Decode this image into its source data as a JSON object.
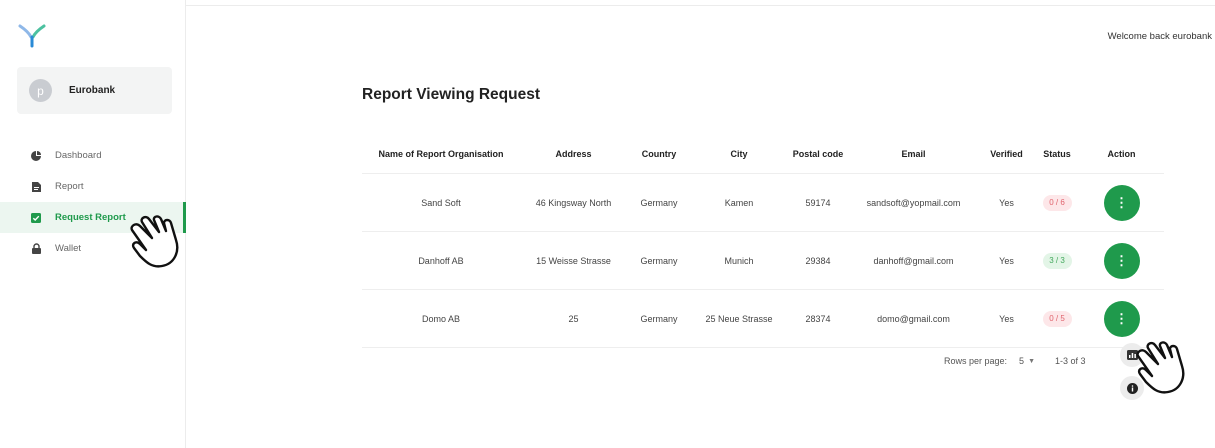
{
  "app": {
    "brand_color": "#1f9a4c"
  },
  "user": {
    "avatar_letter": "p",
    "name": "Eurobank"
  },
  "header": {
    "welcome": "Welcome back eurobank"
  },
  "sidebar": {
    "items": [
      {
        "label": "Dashboard",
        "icon": "pie-chart-icon",
        "active": false
      },
      {
        "label": "Report",
        "icon": "document-icon",
        "active": false
      },
      {
        "label": "Request Report",
        "icon": "checkbox-icon",
        "active": true
      },
      {
        "label": "Wallet",
        "icon": "lock-icon",
        "active": false
      }
    ]
  },
  "main": {
    "title": "Report Viewing Request",
    "table": {
      "columns": [
        "Name of Report Organisation",
        "Address",
        "Country",
        "City",
        "Postal code",
        "Email",
        "Verified",
        "Status",
        "Action"
      ],
      "rows": [
        {
          "name": "Sand Soft",
          "address": "46 Kingsway North",
          "country": "Germany",
          "city": "Kamen",
          "postal": "59174",
          "email": "sandsoft@yopmail.com",
          "verified": "Yes",
          "status": "0 / 6",
          "status_color": "red"
        },
        {
          "name": "Danhoff AB",
          "address": "15 Weisse Strasse",
          "country": "Germany",
          "city": "Munich",
          "postal": "29384",
          "email": "danhoff@gmail.com",
          "verified": "Yes",
          "status": "3 / 3",
          "status_color": "green"
        },
        {
          "name": "Domo AB",
          "address": "25",
          "country": "Germany",
          "city": "25 Neue Strasse",
          "postal": "28374",
          "email": "domo@gmail.com",
          "verified": "Yes",
          "status": "0 / 5",
          "status_color": "red"
        }
      ]
    },
    "pagination": {
      "rows_per_page_label": "Rows per page:",
      "rows_per_page": "5",
      "range": "1-3 of 3"
    }
  }
}
